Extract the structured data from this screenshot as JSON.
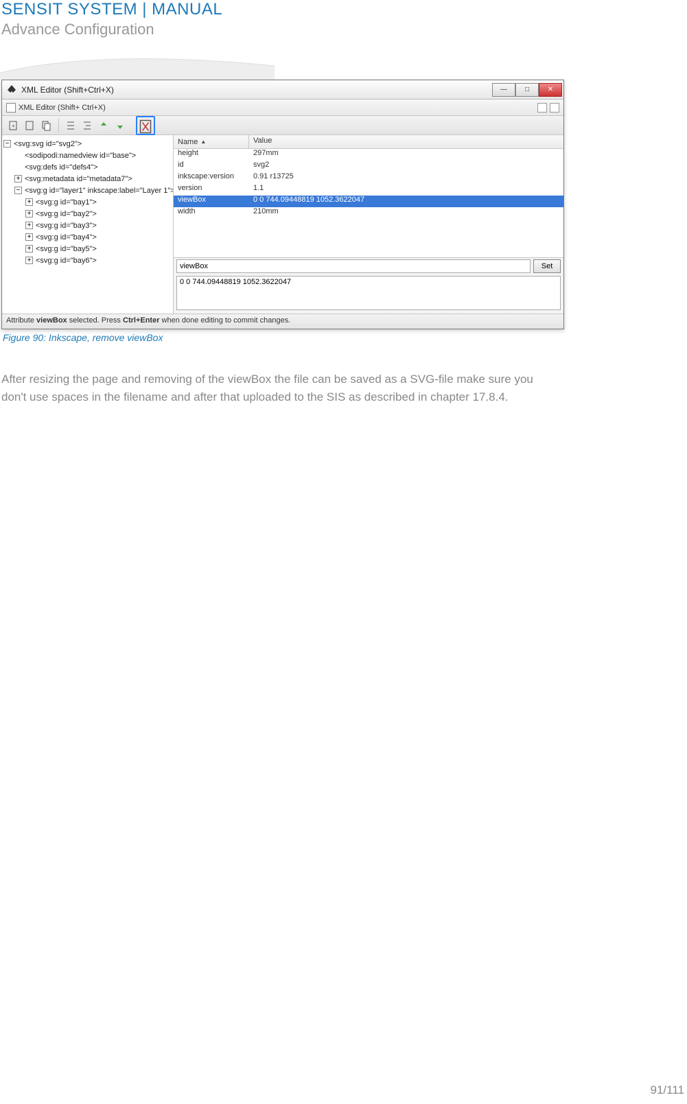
{
  "header": {
    "title": "SENSIT SYSTEM | MANUAL",
    "subtitle": "Advance Configuration"
  },
  "window": {
    "title": "XML Editor (Shift+Ctrl+X)",
    "sub_title": "XML Editor (Shift+ Ctrl+X)"
  },
  "tree": [
    {
      "exp": "−",
      "indent": 0,
      "text": "<svg:svg id=\"svg2\">"
    },
    {
      "exp": "",
      "indent": 1,
      "text": "<sodipodi:namedview id=\"base\">"
    },
    {
      "exp": "",
      "indent": 1,
      "text": "<svg:defs id=\"defs4\">"
    },
    {
      "exp": "+",
      "indent": 1,
      "text": "<svg:metadata id=\"metadata7\">"
    },
    {
      "exp": "−",
      "indent": 1,
      "text": "<svg:g id=\"layer1\" inkscape:label=\"Layer 1\">"
    },
    {
      "exp": "+",
      "indent": 2,
      "text": "<svg:g id=\"bay1\">"
    },
    {
      "exp": "+",
      "indent": 2,
      "text": "<svg:g id=\"bay2\">"
    },
    {
      "exp": "+",
      "indent": 2,
      "text": "<svg:g id=\"bay3\">"
    },
    {
      "exp": "+",
      "indent": 2,
      "text": "<svg:g id=\"bay4\">"
    },
    {
      "exp": "+",
      "indent": 2,
      "text": "<svg:g id=\"bay5\">"
    },
    {
      "exp": "+",
      "indent": 2,
      "text": "<svg:g id=\"bay6\">"
    }
  ],
  "attr_head": {
    "name": "Name",
    "value": "Value"
  },
  "attrs": [
    {
      "n": "height",
      "v": "297mm",
      "sel": false
    },
    {
      "n": "id",
      "v": "svg2",
      "sel": false
    },
    {
      "n": "inkscape:version",
      "v": "0.91 r13725",
      "sel": false
    },
    {
      "n": "version",
      "v": "1.1",
      "sel": false
    },
    {
      "n": "viewBox",
      "v": "0 0 744.09448819 1052.3622047",
      "sel": true
    },
    {
      "n": "width",
      "v": "210mm",
      "sel": false
    }
  ],
  "edit": {
    "name_field": "viewBox",
    "set_label": "Set",
    "value_field": "0 0 744.09448819 1052.3622047"
  },
  "status": {
    "pre": "Attribute ",
    "bold1": "viewBox",
    "mid": " selected. Press ",
    "bold2": "Ctrl+Enter",
    "post": " when done editing to commit changes."
  },
  "caption": "Figure 90: Inkscape, remove viewBox",
  "body_text": "After resizing the page and removing of the viewBox the file can be saved as a SVG-file make sure you don't use spaces in the filename and after that uploaded to the SIS as described in chapter 17.8.4.",
  "page_number": "91/111"
}
